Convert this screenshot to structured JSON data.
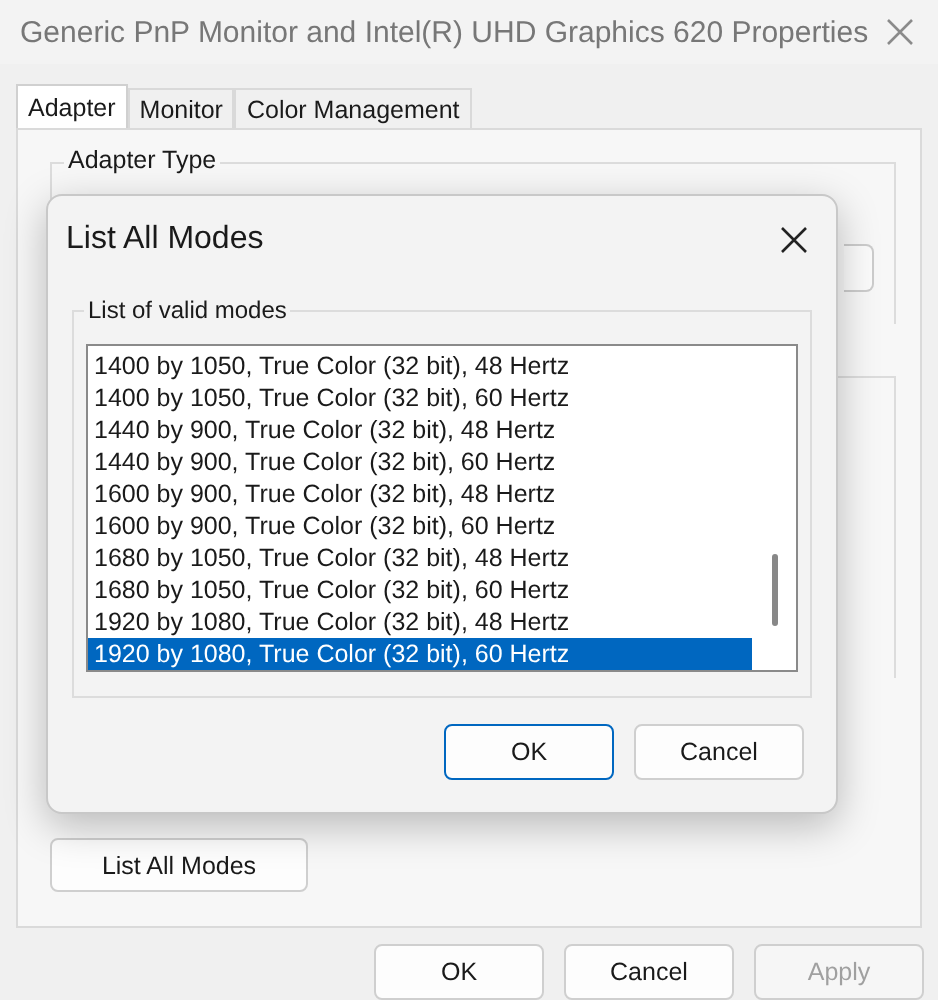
{
  "window": {
    "title": "Generic PnP Monitor and Intel(R) UHD Graphics 620 Properties"
  },
  "tabs": [
    {
      "label": "Adapter",
      "selected": true
    },
    {
      "label": "Monitor",
      "selected": false
    },
    {
      "label": "Color Management",
      "selected": false
    }
  ],
  "adapter_type": {
    "label": "Adapter Type"
  },
  "list_all_modes_button": "List All Modes",
  "buttons": [
    {
      "label": "OK",
      "disabled": false
    },
    {
      "label": "Cancel",
      "disabled": false
    },
    {
      "label": "Apply",
      "disabled": true
    }
  ],
  "dialog": {
    "title": "List All Modes",
    "group_label": "List of valid modes",
    "modes": [
      {
        "text": "1400 by 1050, True Color (32 bit), 48 Hertz",
        "selected": false
      },
      {
        "text": "1400 by 1050, True Color (32 bit), 60 Hertz",
        "selected": false
      },
      {
        "text": "1440 by 900, True Color (32 bit), 48 Hertz",
        "selected": false
      },
      {
        "text": "1440 by 900, True Color (32 bit), 60 Hertz",
        "selected": false
      },
      {
        "text": "1600 by 900, True Color (32 bit), 48 Hertz",
        "selected": false
      },
      {
        "text": "1600 by 900, True Color (32 bit), 60 Hertz",
        "selected": false
      },
      {
        "text": "1680 by 1050, True Color (32 bit), 48 Hertz",
        "selected": false
      },
      {
        "text": "1680 by 1050, True Color (32 bit), 60 Hertz",
        "selected": false
      },
      {
        "text": "1920 by 1080, True Color (32 bit), 48 Hertz",
        "selected": false
      },
      {
        "text": "1920 by 1080, True Color (32 bit), 60 Hertz",
        "selected": true
      }
    ],
    "buttons": [
      {
        "label": "OK",
        "default": true
      },
      {
        "label": "Cancel",
        "default": false
      }
    ]
  }
}
